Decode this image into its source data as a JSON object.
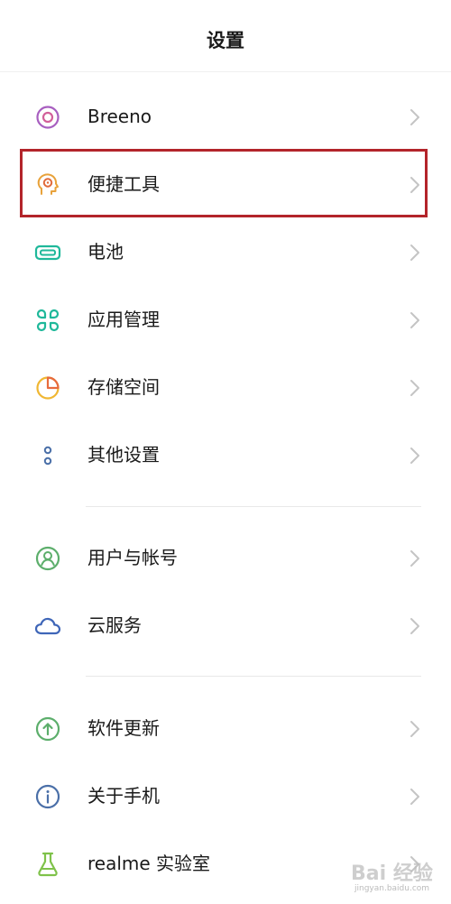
{
  "header": {
    "title": "设置"
  },
  "items": [
    {
      "label": "Breeno",
      "icon": "breeno-icon",
      "color": "#a85fc0"
    },
    {
      "label": "便捷工具",
      "icon": "convenience-tools-icon",
      "color": "#e8a23a"
    },
    {
      "label": "电池",
      "icon": "battery-icon",
      "color": "#1fb89a"
    },
    {
      "label": "应用管理",
      "icon": "app-management-icon",
      "color": "#1fb89a"
    },
    {
      "label": "存储空间",
      "icon": "storage-icon",
      "color": "#f0b733"
    },
    {
      "label": "其他设置",
      "icon": "other-settings-icon",
      "color": "#4a6fa8"
    },
    {
      "label": "用户与帐号",
      "icon": "user-account-icon",
      "color": "#5cae6b"
    },
    {
      "label": "云服务",
      "icon": "cloud-icon",
      "color": "#3f66b8"
    },
    {
      "label": "软件更新",
      "icon": "update-icon",
      "color": "#5cae6b"
    },
    {
      "label": "关于手机",
      "icon": "info-icon",
      "color": "#4a6fa8"
    },
    {
      "label": "realme 实验室",
      "icon": "lab-flask-icon",
      "color": "#7fc24a"
    }
  ],
  "highlight": {
    "target": "便捷工具",
    "color": "#b3242a"
  },
  "watermark": {
    "text": "Bai 经验",
    "sub": "jingyan.baidu.com"
  }
}
